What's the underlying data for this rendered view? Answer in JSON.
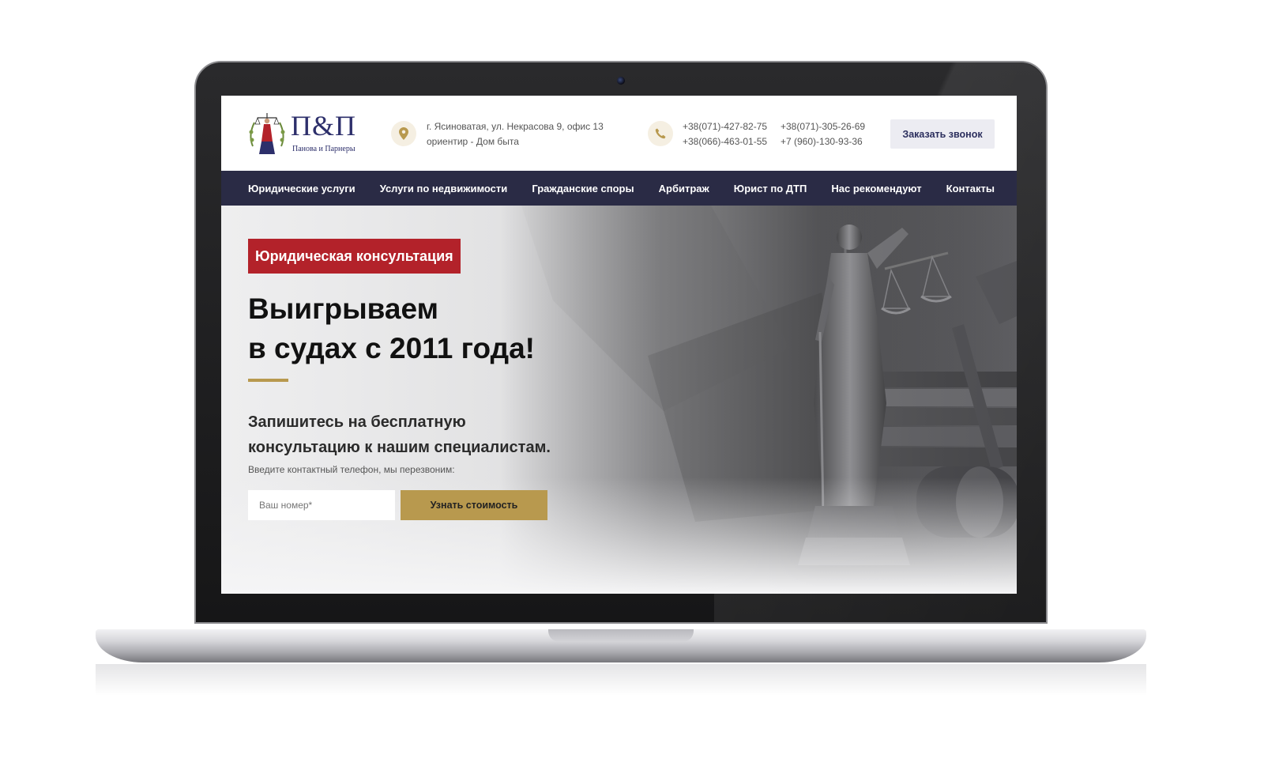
{
  "header": {
    "logo": {
      "mark": "П&П",
      "subtitle": "Панова и Парнеры"
    },
    "address": {
      "line1": "г. Ясиноватая, ул. Некрасова 9, офис 13",
      "line2": "ориентир - Дом быта",
      "icon": "location-pin-icon"
    },
    "phones": {
      "col1": [
        "+38(071)-427-82-75",
        "+38(066)-463-01-55"
      ],
      "col2": [
        "+38(071)-305-26-69",
        "+7 (960)-130-93-36"
      ],
      "icon": "phone-icon"
    },
    "callback_label": "Заказать звонок"
  },
  "nav": {
    "items": [
      {
        "label": "Юридические услуги"
      },
      {
        "label": "Услуги по недвижимости"
      },
      {
        "label": "Гражданские споры"
      },
      {
        "label": "Арбитраж"
      },
      {
        "label": "Юрист по ДТП"
      },
      {
        "label": "Нас рекомендуют"
      },
      {
        "label": "Контакты"
      }
    ]
  },
  "hero": {
    "badge": "Юридическая консультация",
    "headline": {
      "line1": "Выигрываем",
      "line2": "в судах с 2011 года!"
    },
    "subheadline": {
      "line1": "Запишитесь на бесплатную",
      "line2": "консультацию к нашим специалистам."
    },
    "hint": "Введите контактный телефон, мы перезвоним:",
    "phone_placeholder": "Ваш номер*",
    "submit_label": "Узнать стоимость"
  },
  "colors": {
    "nav_bg": "#2a2b45",
    "badge_red": "#b3222a",
    "gold": "#b8994e",
    "brand_navy": "#2d2f6b"
  }
}
